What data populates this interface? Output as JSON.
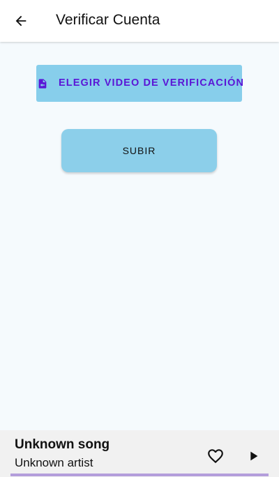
{
  "appbar": {
    "title": "Verificar Cuenta",
    "back_icon": "arrow-back-icon"
  },
  "main": {
    "choose_video_label": "ELEGIR VIDEO DE VERIFICACIÓN",
    "choose_video_icon": "video-file-icon",
    "upload_label": "SUBIR"
  },
  "player": {
    "song_title": "Unknown song",
    "song_artist": "Unknown artist",
    "favorite_icon": "heart-outline-icon",
    "play_icon": "play-icon",
    "progress": 0
  },
  "colors": {
    "appbar_bg": "#ffffff",
    "page_bg": "#f5fafd",
    "button_bg": "#87ceeb",
    "accent_text": "#5a16d6",
    "player_bg": "#f1f1f1",
    "progress_track": "#b39ddb"
  }
}
